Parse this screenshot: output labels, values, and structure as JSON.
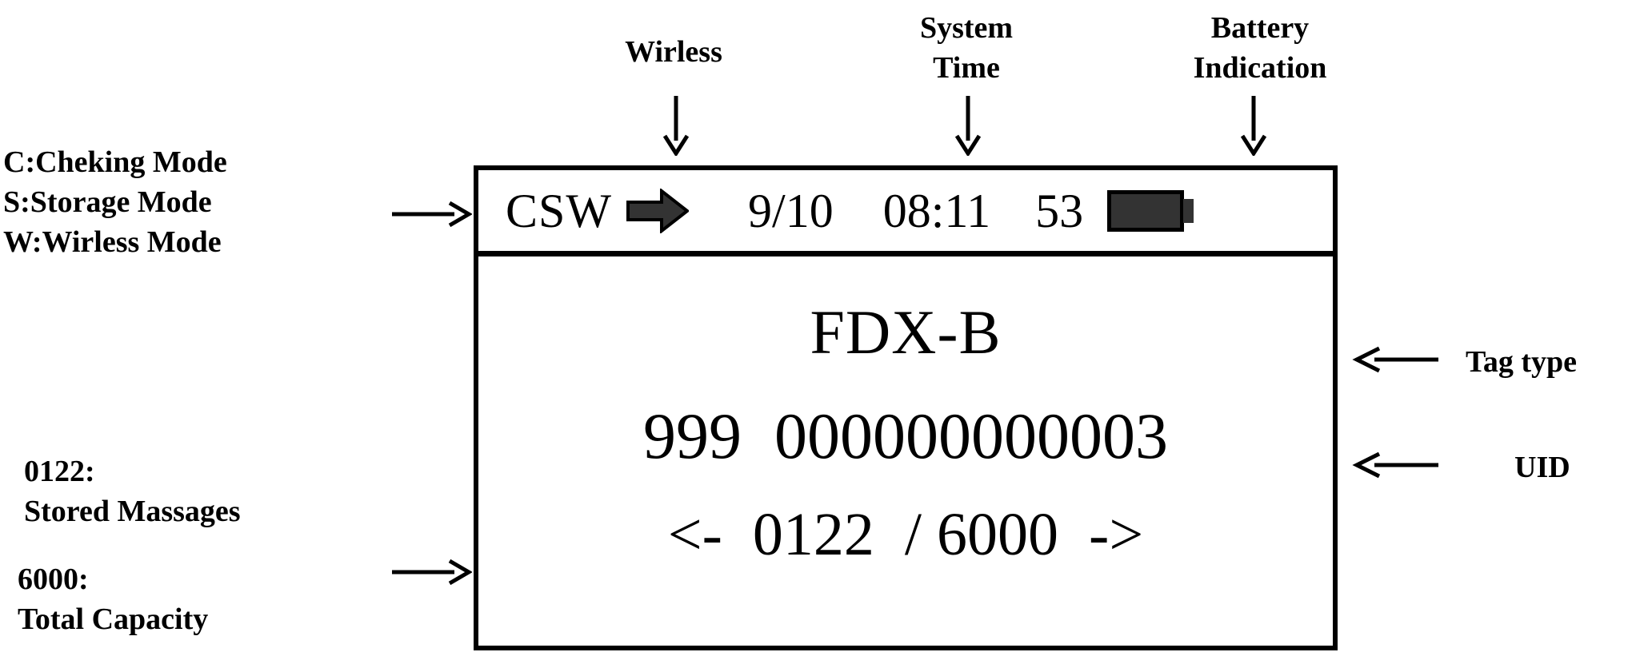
{
  "annotations": {
    "wireless_label": "Wirless",
    "system_time_label": "System\nTime",
    "battery_label": "Battery\nIndication",
    "mode_legend": "C:Cheking Mode\nS:Storage Mode\nW:Wirless Mode",
    "stored_messages_label": "0122:\nStored Massages",
    "total_capacity_label": "6000:\nTotal Capacity",
    "tag_type_label": "Tag type",
    "uid_label": "UID"
  },
  "device": {
    "status_bar": {
      "mode_text": "CSW",
      "wireless_icon": "arrow-right-icon",
      "date": "9/10",
      "time": "08:11",
      "battery_percent": "53",
      "battery_icon": "battery-full-icon"
    },
    "main": {
      "tag_type": "FDX-B",
      "uid": "999  000000000003",
      "record_nav": "<-  0122  / 6000  ->",
      "record_index": "0122",
      "record_total": "6000",
      "prev_arrow": "<-",
      "next_arrow": "->"
    }
  },
  "colors": {
    "frame": "#000000",
    "background": "#ffffff",
    "icon_fill": "#333333"
  }
}
